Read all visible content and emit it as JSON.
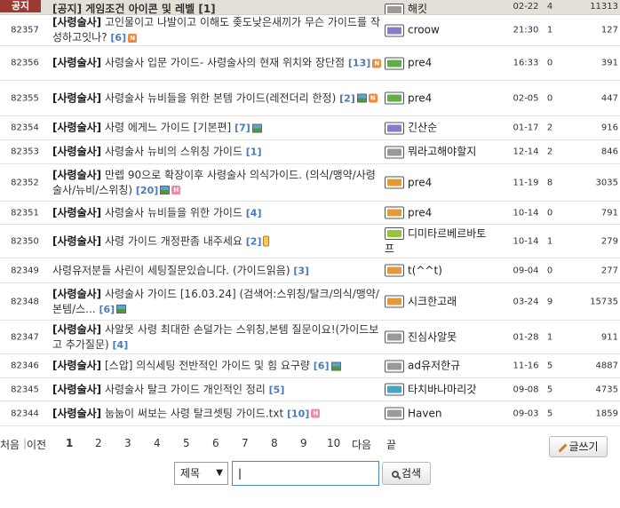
{
  "notice": {
    "badge": "공지",
    "title": "[공지] 게임조건 아이콘 및 레벨 [1]",
    "author": "해킷",
    "date": "02-22",
    "recommend": "4",
    "hits": "11313"
  },
  "posts": [
    {
      "num": "82357",
      "tag": "[사령술사]",
      "text": "고인물이고 나발이고 이해도 좆도낮은새끼가 무슨 가이드를 작성하고잇나?",
      "comments": "[6]",
      "icons": [
        "new"
      ],
      "author": "croow",
      "level": "purple",
      "date": "21:30",
      "recommend": "1",
      "hits": "127"
    },
    {
      "num": "82356",
      "tag": "[사령술사]",
      "text": "사령술사 입문 가이드- 사령술사의 현재 위치와 장단점",
      "comments": "[13]",
      "icons": [
        "new"
      ],
      "author": "pre4",
      "level": "green",
      "date": "16:33",
      "recommend": "0",
      "hits": "391"
    },
    {
      "num": "82355",
      "tag": "[사령술사]",
      "text": "사령술사 뉴비들을 위한 본템 가이드(레전더리 한정)",
      "comments": "[2]",
      "icons": [
        "img",
        "new"
      ],
      "author": "pre4",
      "level": "green",
      "date": "02-05",
      "recommend": "0",
      "hits": "447"
    },
    {
      "num": "82354",
      "tag": "[사령술사]",
      "text": "사령 에게느 가이드 [기본편]",
      "comments": "[7]",
      "icons": [
        "img"
      ],
      "author": "긴산순",
      "level": "purple",
      "date": "01-17",
      "recommend": "2",
      "hits": "916"
    },
    {
      "num": "82353",
      "tag": "[사령술사]",
      "text": "사령술사 뉴비의 스위칭 가이드",
      "comments": "[1]",
      "icons": [],
      "author": "뭐라고해야할지",
      "level": "gray",
      "date": "12-14",
      "recommend": "2",
      "hits": "846"
    },
    {
      "num": "82352",
      "tag": "[사령술사]",
      "text": "만렙 90으로 확장이후 사령술사 의식가이드. (의식/맹약/사령술사/뉴비/스위칭)",
      "comments": "[20]",
      "icons": [
        "img",
        "hot"
      ],
      "author": "pre4",
      "level": "orange",
      "date": "11-19",
      "recommend": "8",
      "hits": "3035"
    },
    {
      "num": "82351",
      "tag": "[사령술사]",
      "text": "사령술사 뉴비들을 위한 가이드",
      "comments": "[4]",
      "icons": [],
      "author": "pre4",
      "level": "orange",
      "date": "10-14",
      "recommend": "0",
      "hits": "791"
    },
    {
      "num": "82350",
      "tag": "[사령술사]",
      "text": "사령 가이드 개정판좀 내주세요",
      "comments": "[2]",
      "icons": [
        "mobile"
      ],
      "author": "디미타르베르바토프",
      "level": "lime",
      "date": "10-14",
      "recommend": "1",
      "hits": "279"
    },
    {
      "num": "82349",
      "tag": "",
      "text": "사령유저분들 사린이 세팅질문있습니다. (가이드읽음)",
      "comments": "[3]",
      "icons": [],
      "author": "t(^^t)",
      "level": "orange",
      "date": "09-04",
      "recommend": "0",
      "hits": "277"
    },
    {
      "num": "82348",
      "tag": "[사령술사]",
      "text": "사령술사 가이드 [16.03.24] (검색어:스위칭/탈크/의식/맹약/본템/스...",
      "comments": "[6]",
      "icons": [
        "img"
      ],
      "author": "시크한고래",
      "level": "orange",
      "date": "03-24",
      "recommend": "9",
      "hits": "15735"
    },
    {
      "num": "82347",
      "tag": "[사령술사]",
      "text": "사알못 사령 최대한 손덜가는 스위칭,본템 질문이요!(가이드보고 추가질문)",
      "comments": "[4]",
      "icons": [],
      "author": "진심사알못",
      "level": "gray",
      "date": "01-28",
      "recommend": "1",
      "hits": "911"
    },
    {
      "num": "82346",
      "tag": "[사령술사]",
      "text": "[스압] 의식세팅 전반적인 가이드 및 힘 요구량",
      "comments": "[6]",
      "icons": [
        "img"
      ],
      "author": "ad유저한규",
      "level": "gray",
      "date": "11-16",
      "recommend": "5",
      "hits": "4887"
    },
    {
      "num": "82345",
      "tag": "[사령술사]",
      "text": "사령술사 탈크 가이드 개인적인 정리",
      "comments": "[5]",
      "icons": [],
      "author": "타치바나마리갓",
      "level": "teal",
      "date": "09-08",
      "recommend": "5",
      "hits": "4735"
    },
    {
      "num": "82344",
      "tag": "[사령술사]",
      "text": "눕눕이 써보는 사령 탈크셋팅 가이드.txt",
      "comments": "[10]",
      "icons": [
        "hot"
      ],
      "author": "Haven",
      "level": "gray",
      "date": "09-03",
      "recommend": "5",
      "hits": "1859"
    }
  ],
  "pager": {
    "first": "처음",
    "prev": "이전",
    "pages": [
      "1",
      "2",
      "3",
      "4",
      "5",
      "6",
      "7",
      "8",
      "9",
      "10"
    ],
    "current": "1",
    "next": "다음",
    "last": "끝"
  },
  "write_label": "글쓰기",
  "search": {
    "option": "제목",
    "value": "|",
    "button": "검색"
  }
}
